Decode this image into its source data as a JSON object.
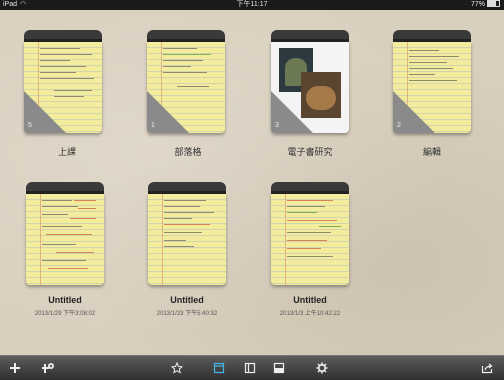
{
  "status_bar": {
    "device": "iPad",
    "time": "下午11:17",
    "battery": "77%",
    "battery_level": 0.77
  },
  "notebooks": [
    {
      "title": "上課",
      "count": "5",
      "cover": "lined"
    },
    {
      "title": "部落格",
      "count": "1",
      "cover": "lined"
    },
    {
      "title": "電子書研究",
      "count": "3",
      "cover": "photo"
    },
    {
      "title": "編輯",
      "count": "2",
      "cover": "lined"
    }
  ],
  "notes": [
    {
      "title": "Untitled",
      "date": "2013/1/29 下午3:08:02"
    },
    {
      "title": "Untitled",
      "date": "2013/1/23 下午5:40:32"
    },
    {
      "title": "Untitled",
      "date": "2013/1/3 上午10:42:22"
    }
  ],
  "toolbar": {
    "items": [
      "add-icon",
      "add-notebook-icon",
      "star-icon",
      "grid-view-icon",
      "split-view-icon",
      "list-view-icon",
      "settings-icon",
      "share-icon"
    ],
    "active_color": "#3fb6e6"
  }
}
